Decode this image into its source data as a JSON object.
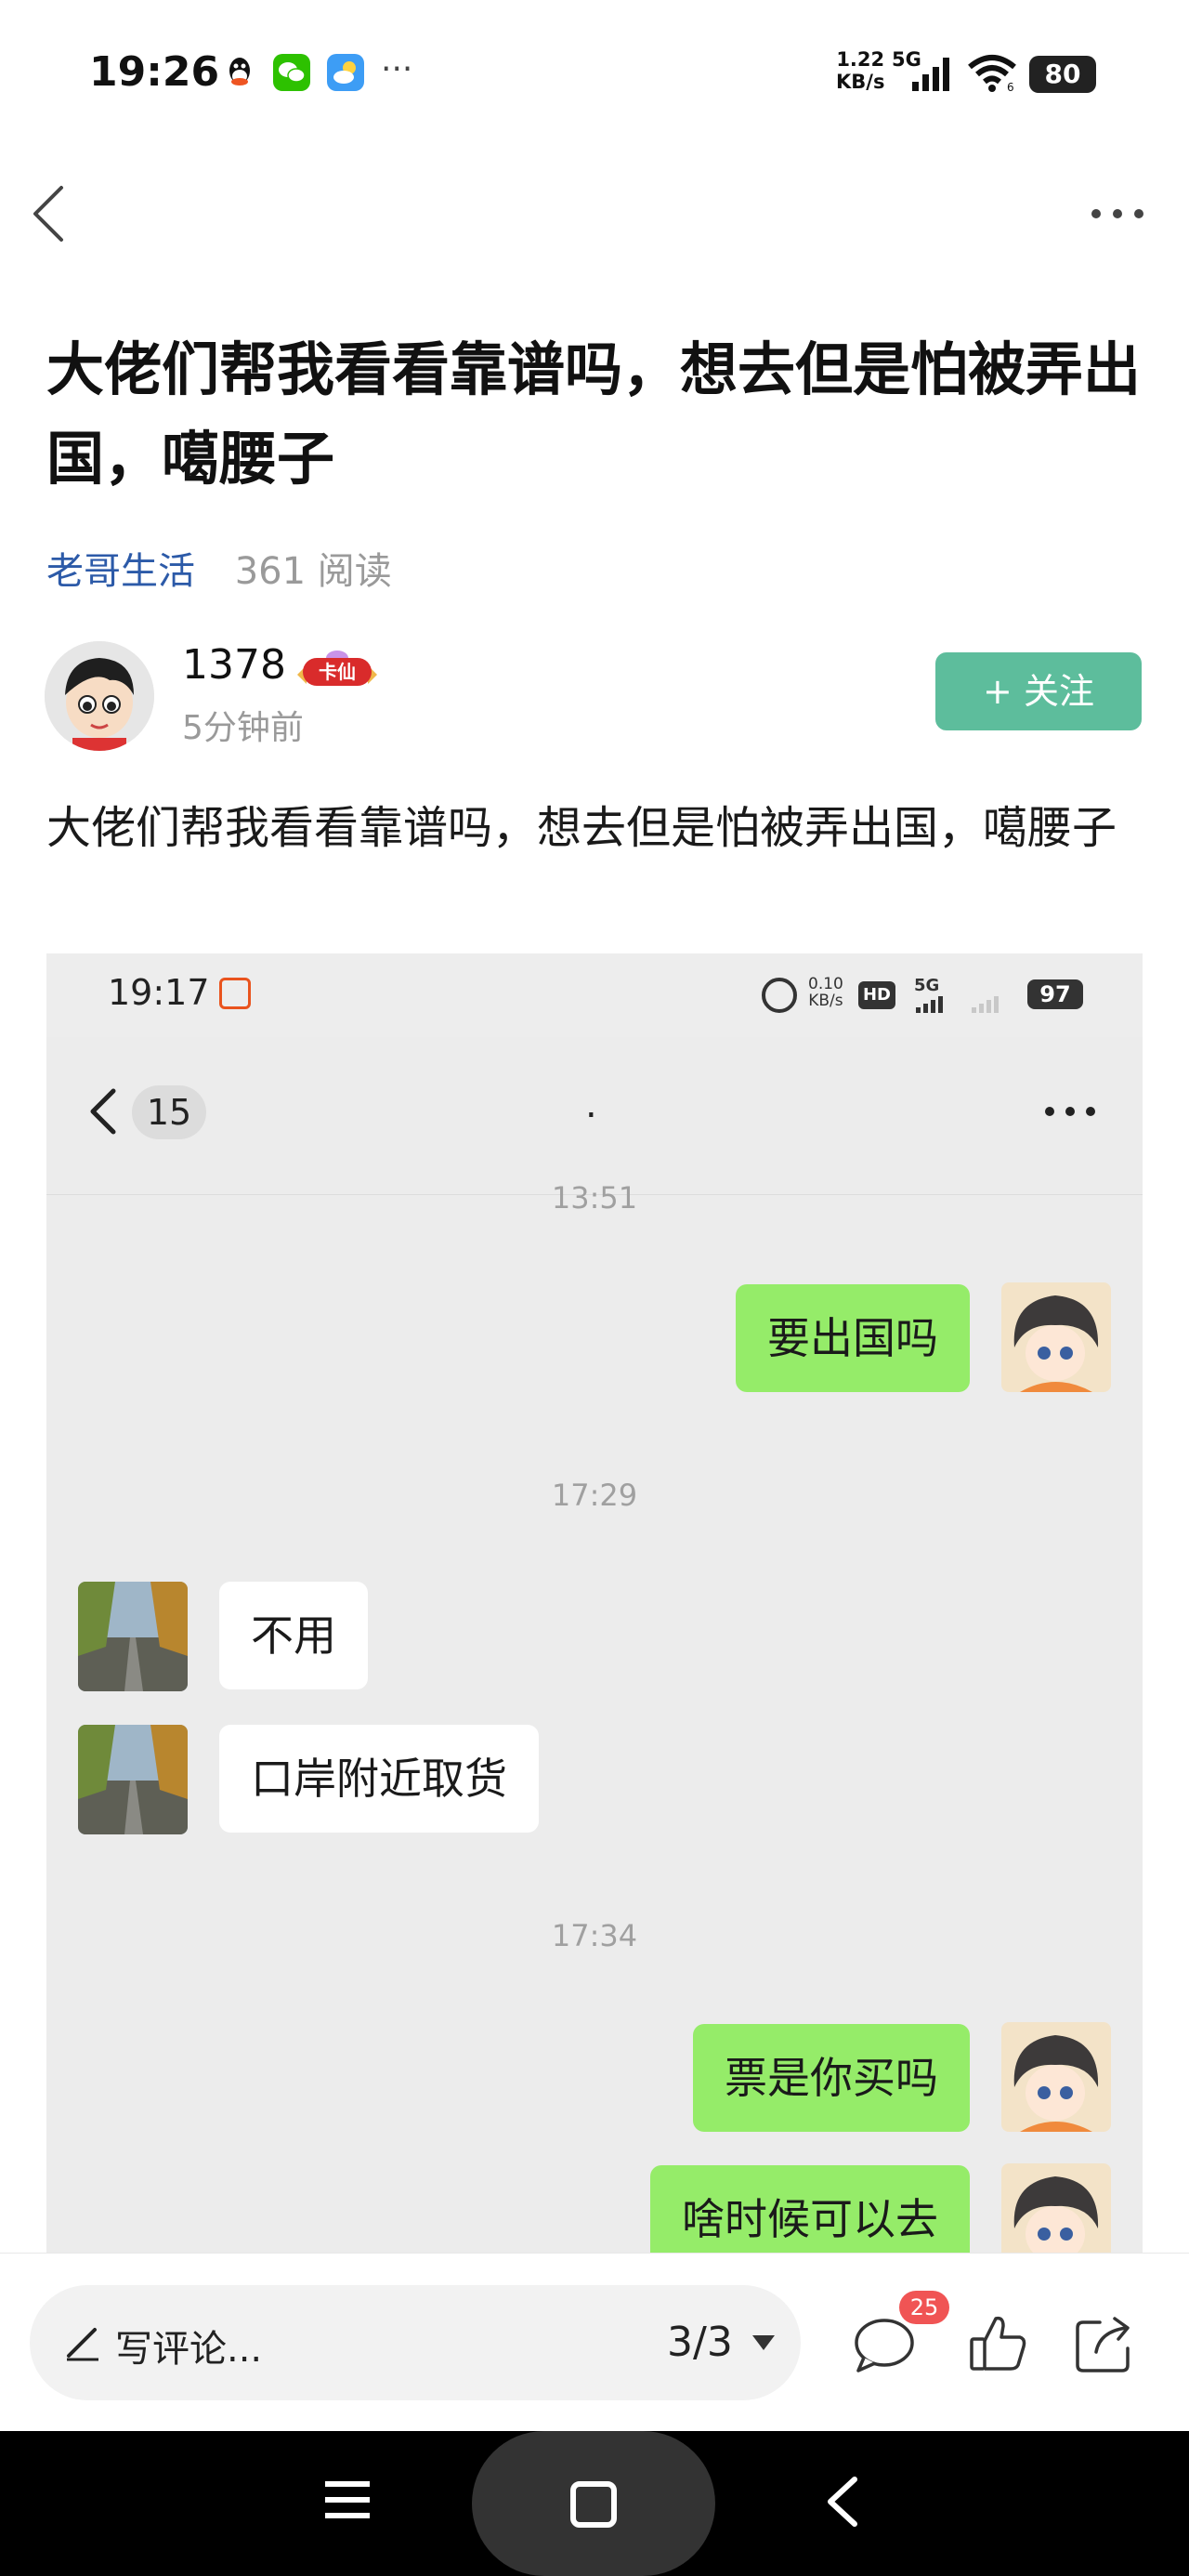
{
  "status_bar": {
    "time": "19:26",
    "net_speed_value": "1.22",
    "net_speed_unit": "KB/s",
    "network": "5G",
    "wifi_label": "6",
    "battery": "80"
  },
  "article": {
    "title": "大佬们帮我看看靠谱吗，想去但是怕被弄出国，噶腰子",
    "category": "老哥生活",
    "reads": "361 阅读",
    "author": {
      "name": "1378",
      "badge": "卡仙",
      "time": "5分钟前",
      "follow_label": "+ 关注"
    },
    "body": "大佬们帮我看看靠谱吗，想去但是怕被弄出国，噶腰子"
  },
  "embedded_chat": {
    "status": {
      "time": "19:17",
      "speed_value": "0.10",
      "speed_unit": "KB/s",
      "hd": "HD",
      "network": "5G",
      "battery": "97"
    },
    "unread_count": "15",
    "contact_name": ".",
    "timestamps": [
      "13:51",
      "17:29",
      "17:34"
    ],
    "messages": [
      {
        "from": "me",
        "text": "要出国吗"
      },
      {
        "from": "them",
        "text": "不用"
      },
      {
        "from": "them",
        "text": "口岸附近取货"
      },
      {
        "from": "me",
        "text": "票是你买吗"
      },
      {
        "from": "me",
        "text": "啥时候可以去"
      }
    ]
  },
  "toolbar": {
    "comment_placeholder": "写评论...",
    "page_indicator": "3/3",
    "comment_count": "25"
  },
  "colors": {
    "follow": "#5dbd9c",
    "category_link": "#2c5aa8",
    "my_bubble": "#95ec69",
    "badge_red": "#f05454"
  }
}
